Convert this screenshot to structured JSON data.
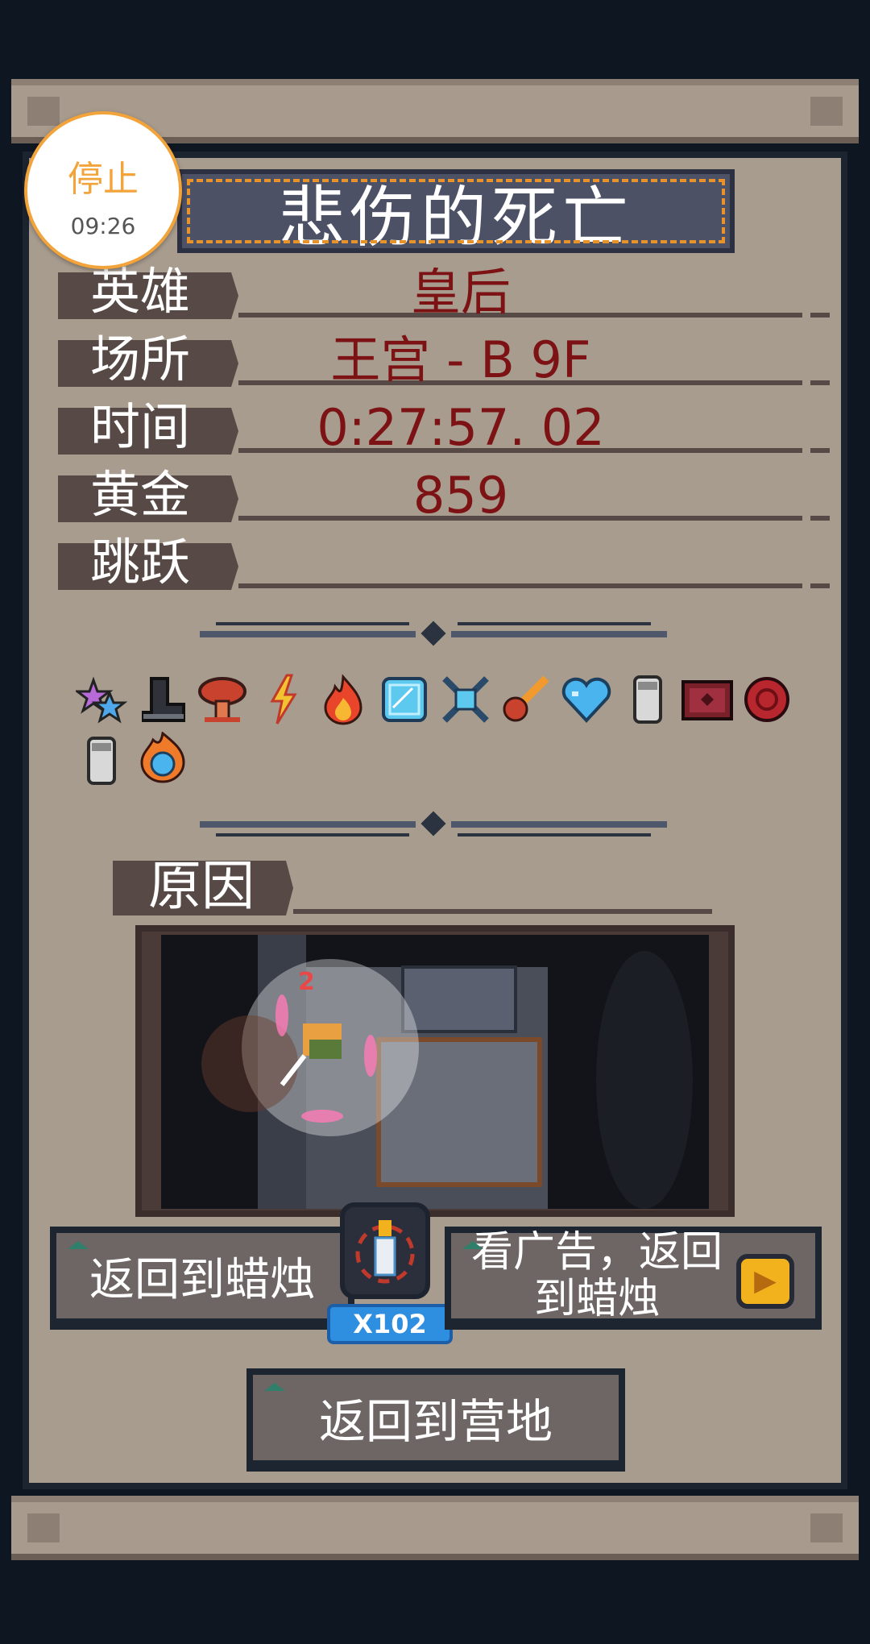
{
  "title": "悲伤的死亡",
  "recorder": {
    "stop_label": "停止",
    "time": "09:26"
  },
  "stats": [
    {
      "label": "英雄",
      "value": "皇后"
    },
    {
      "label": "场所",
      "value": "王宫 - B 9F"
    },
    {
      "label": "时间",
      "value": "0:27:57. 02"
    },
    {
      "label": "黄金",
      "value": "859"
    },
    {
      "label": "跳跃",
      "value": ""
    }
  ],
  "items": [
    "star-sparkle-icon",
    "boot-icon",
    "mushroom-cloud-icon",
    "lightning-icon",
    "fire-icon",
    "ice-cube-icon",
    "crossed-crystal-icon",
    "meteor-icon",
    "blue-heart-icon",
    "milk-bottle-icon",
    "red-chest-icon",
    "red-orb-icon",
    "milk-bottle-icon",
    "fire-ring-icon"
  ],
  "reason": {
    "label": "原因"
  },
  "buttons": {
    "return_candle": "返回到蜡烛",
    "watch_ad": "看广告，返回到蜡烛",
    "return_camp": "返回到营地"
  },
  "candle_count": "X102",
  "colors": {
    "background": "#0e1622",
    "panel": "#a89c8f",
    "stat_value": "#7d1215",
    "banner": "#4d5166",
    "banner_trim": "#e8932a",
    "recorder_accent": "#f2a33a"
  }
}
